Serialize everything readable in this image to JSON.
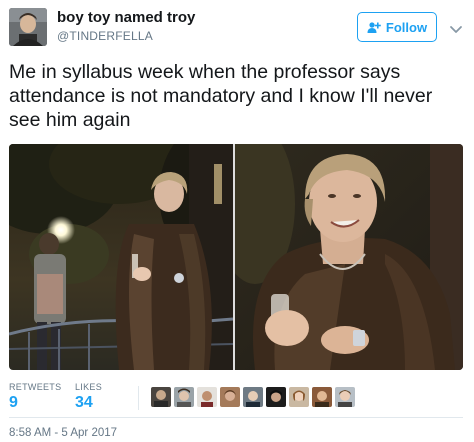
{
  "author": {
    "name": "boy toy named troy",
    "handle": "@TINDERFELLA"
  },
  "follow_button": {
    "label": "Follow",
    "icon": "add-user-icon"
  },
  "more_menu": {
    "icon": "chevron-down-icon"
  },
  "tweet": {
    "text": "Me in syllabus week when the professor says attendance is not mandatory and I know I'll never see him again"
  },
  "media": {
    "photos": [
      {
        "icon": "photo-woman-fur-coat-wide"
      },
      {
        "icon": "photo-woman-fur-coat-closeup"
      }
    ]
  },
  "stats": {
    "retweets_label": "RETWEETS",
    "retweets_value": "9",
    "likes_label": "LIKES",
    "likes_value": "34"
  },
  "likers_count": 9,
  "timestamp": "8:58 AM - 5 Apr 2017",
  "colors": {
    "accent": "#1da1f2",
    "text": "#14171a",
    "secondary": "#657786",
    "divider": "#e1e8ed"
  }
}
